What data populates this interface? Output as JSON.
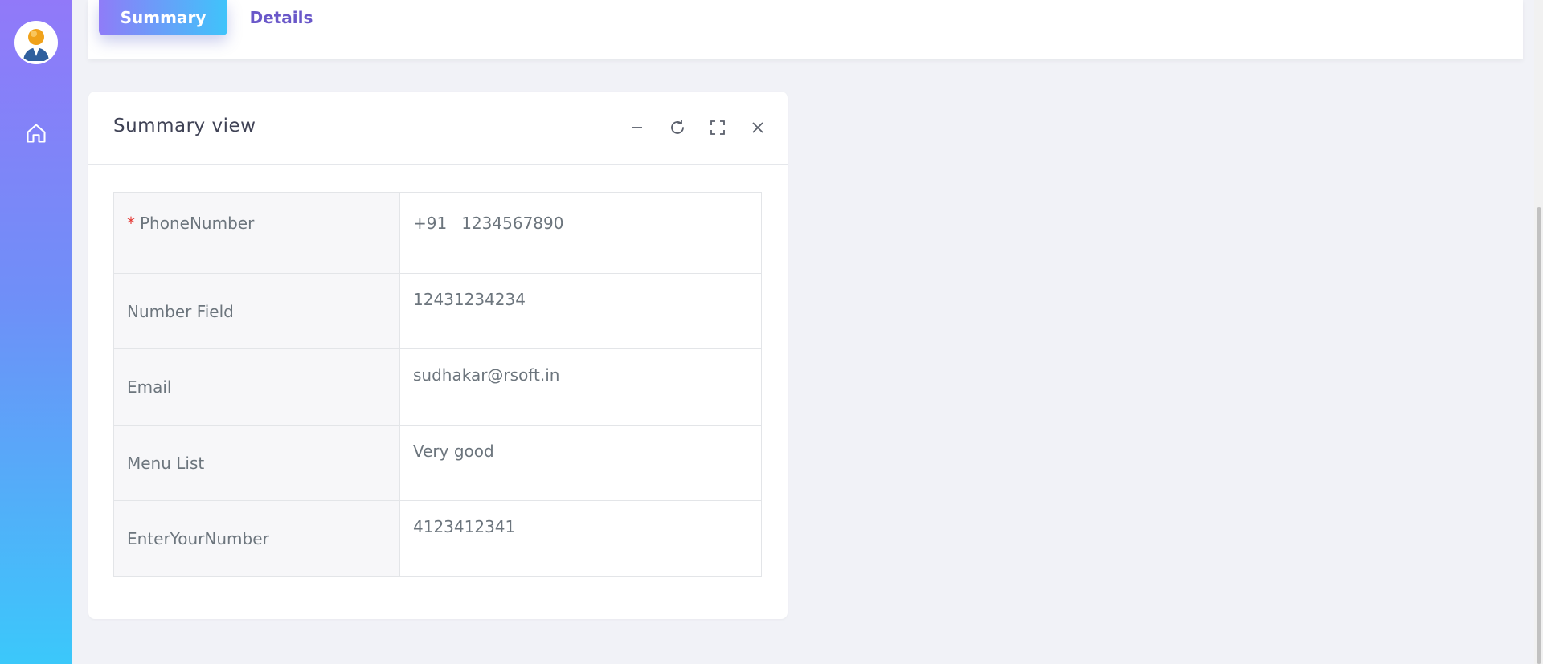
{
  "sidebar": {
    "avatar_icon": "user-avatar-icon",
    "home_icon": "home-icon"
  },
  "tabs": {
    "summary_label": "Summary",
    "details_label": "Details"
  },
  "card": {
    "title": "Summary view",
    "actions": [
      "minimize-icon",
      "refresh-icon",
      "fullscreen-icon",
      "close-icon"
    ]
  },
  "fields": {
    "phone": {
      "required_mark": "*",
      "label": "PhoneNumber",
      "code": "+91",
      "value": "1234567890"
    },
    "number_field": {
      "label": "Number Field",
      "value": "12431234234"
    },
    "email": {
      "label": "Email",
      "value": "sudhakar@rsoft.in"
    },
    "menu_list": {
      "label": "Menu List",
      "value": "Very good"
    },
    "enter_your_number": {
      "label": "EnterYourNumber",
      "value": "4123412341"
    }
  },
  "colors": {
    "sidebar_gradient_top": "#9179f9",
    "sidebar_gradient_bottom": "#3bc8fa",
    "tab_active_text": "#ffffff",
    "tab_inactive_text": "#6a58c9",
    "required": "#e53935"
  }
}
